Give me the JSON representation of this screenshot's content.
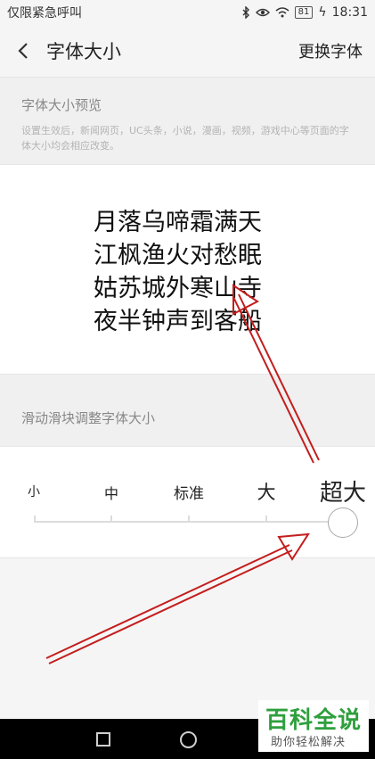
{
  "status_bar": {
    "carrier": "仅限紧急呼叫",
    "icons": [
      "bluetooth-icon",
      "eye-icon",
      "wifi-icon"
    ],
    "battery": "81",
    "time": "18:31"
  },
  "nav": {
    "back_icon": "‹",
    "title": "字体大小",
    "action": "更换字体"
  },
  "preview": {
    "title": "字体大小预览",
    "desc": "设置生效后，新闻网页，UC头条，小说，漫画，视频，游戏中心等页面的字体大小均会相应改变。",
    "poem": [
      "月落乌啼霜满天",
      "江枫渔火对愁眠",
      "姑苏城外寒山寺",
      "夜半钟声到客船"
    ]
  },
  "slider": {
    "title": "滑动滑块调整字体大小",
    "sizes": [
      "小",
      "中",
      "标准",
      "大",
      "超大"
    ],
    "selected": "超大"
  },
  "colors": {
    "arrow": "#c41d1d",
    "watermark_green": "#2e9f3d"
  },
  "watermark": {
    "logo": "百科全说",
    "sub": "助你轻松解决"
  }
}
